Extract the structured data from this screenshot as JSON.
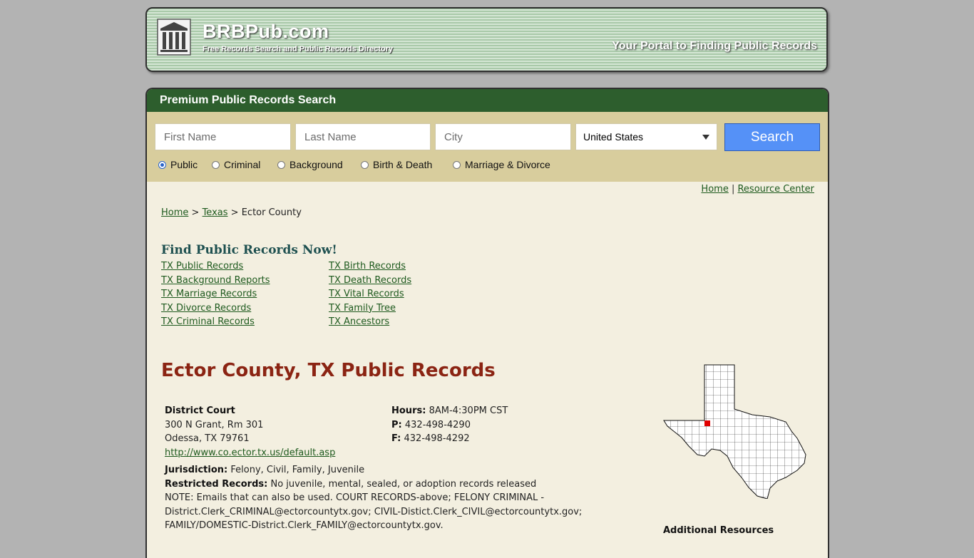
{
  "header": {
    "site_name": "BRBPub.com",
    "site_subtitle": "Free Records Search and Public Records Directory",
    "tagline": "Your Portal to Finding Public Records"
  },
  "search": {
    "heading": "Premium Public Records Search",
    "first_name_placeholder": "First Name",
    "last_name_placeholder": "Last Name",
    "city_placeholder": "City",
    "country_selected": "United States",
    "button_label": "Search",
    "types": [
      {
        "label": "Public",
        "checked": true
      },
      {
        "label": "Criminal",
        "checked": false
      },
      {
        "label": "Background",
        "checked": false
      },
      {
        "label": "Birth & Death",
        "checked": false
      },
      {
        "label": "Marriage & Divorce",
        "checked": false
      }
    ]
  },
  "toplinks": {
    "home": "Home",
    "separator": "|",
    "resource_center": "Resource Center"
  },
  "breadcrumb": {
    "home": "Home",
    "state": "Texas",
    "current": "Ector County",
    "sep": ">"
  },
  "find": {
    "title": "Find Public Records Now!",
    "left_links": [
      "TX Public Records",
      "TX Background Reports",
      "TX Marriage Records",
      "TX Divorce Records",
      "TX Criminal Records"
    ],
    "right_links": [
      "TX Birth Records",
      "TX Death Records",
      "TX Vital Records",
      "TX Family Tree",
      "TX Ancestors"
    ]
  },
  "county": {
    "title": "Ector County, TX Public Records",
    "office_name": "District Court",
    "address1": "300 N Grant, Rm 301",
    "address2": "Odessa, TX 79761",
    "website": "http://www.co.ector.tx.us/default.asp",
    "hours_label": "Hours:",
    "hours": "8AM-4:30PM CST",
    "phone_label": "P:",
    "phone": "432-498-4290",
    "fax_label": "F:",
    "fax": "432-498-4292",
    "jurisdiction_label": "Jurisdiction:",
    "jurisdiction": "Felony, Civil, Family, Juvenile",
    "restricted_label": "Restricted Records:",
    "restricted": "No juvenile, mental, sealed, or adoption records released",
    "note_line1": "NOTE: Emails that can also be used. COURT RECORDS-above; FELONY CRIMINAL -",
    "note_line2": "District.Clerk_CRIMINAL@ectorcountytx.gov; CIVIL-Distict.Clerk_CIVIL@ectorcountytx.gov;",
    "note_line3": "FAMILY/DOMESTIC-District.Clerk_FAMILY@ectorcountytx.gov."
  },
  "sidebar": {
    "additional_resources": "Additional Resources"
  },
  "colors": {
    "accent_green": "#2d5e2d",
    "search_blue": "#5591f7",
    "title_red": "#8b2413",
    "highlight_county": "#e00000"
  }
}
